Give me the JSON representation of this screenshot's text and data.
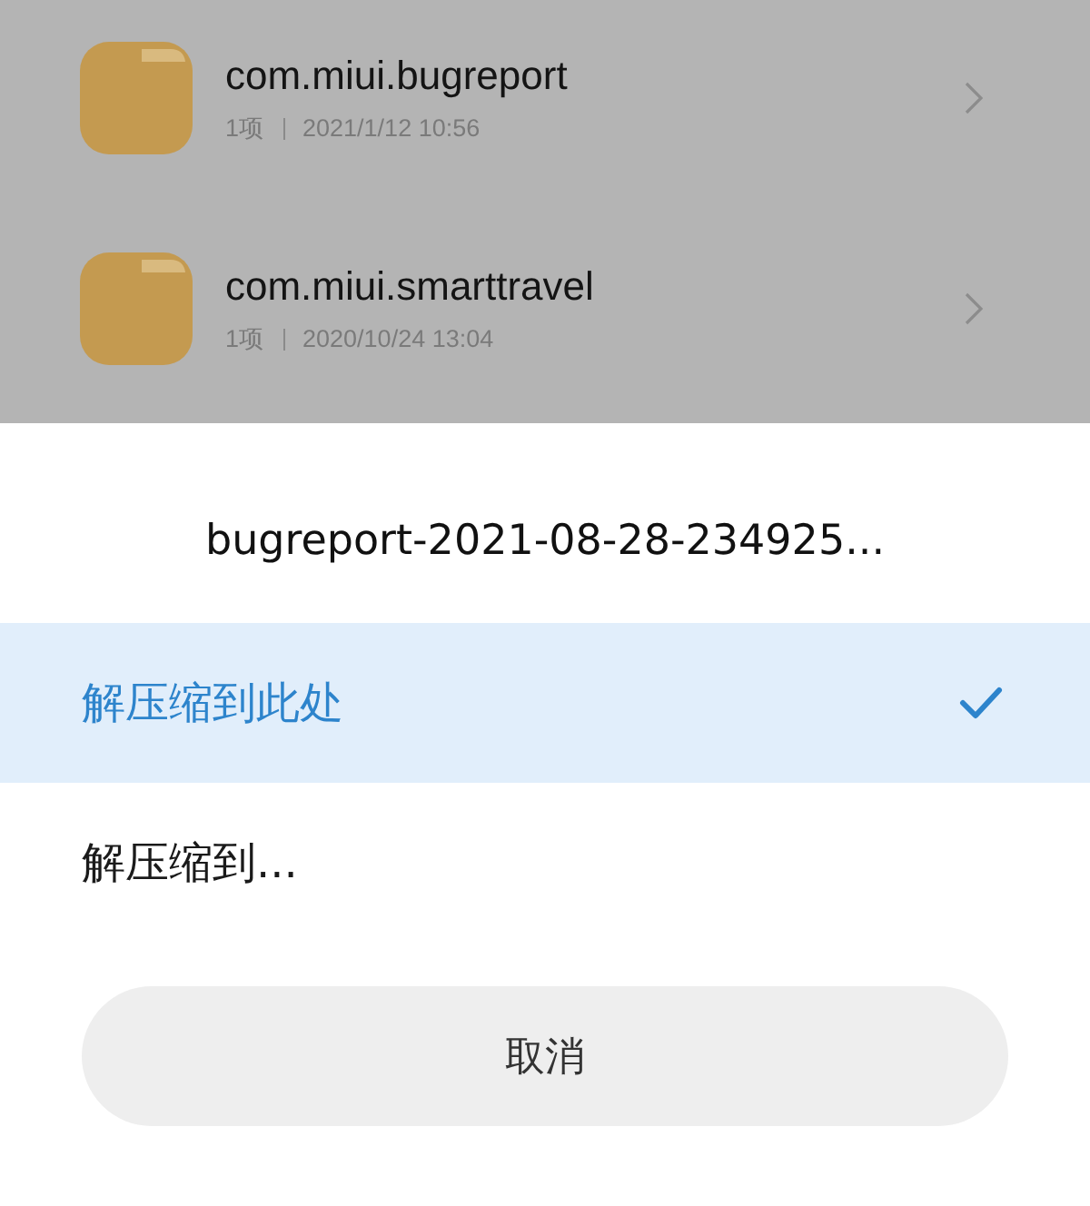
{
  "files": [
    {
      "name": "com.miui.bugreport",
      "count": "1项",
      "date": "2021/1/12 10:56"
    },
    {
      "name": "com.miui.smarttravel",
      "count": "1项",
      "date": "2020/10/24 13:04"
    }
  ],
  "sheet": {
    "title": "bugreport-2021-08-28-234925...",
    "options": [
      {
        "label": "解压缩到此处",
        "selected": true
      },
      {
        "label": "解压缩到...",
        "selected": false
      }
    ],
    "cancel": "取消"
  }
}
